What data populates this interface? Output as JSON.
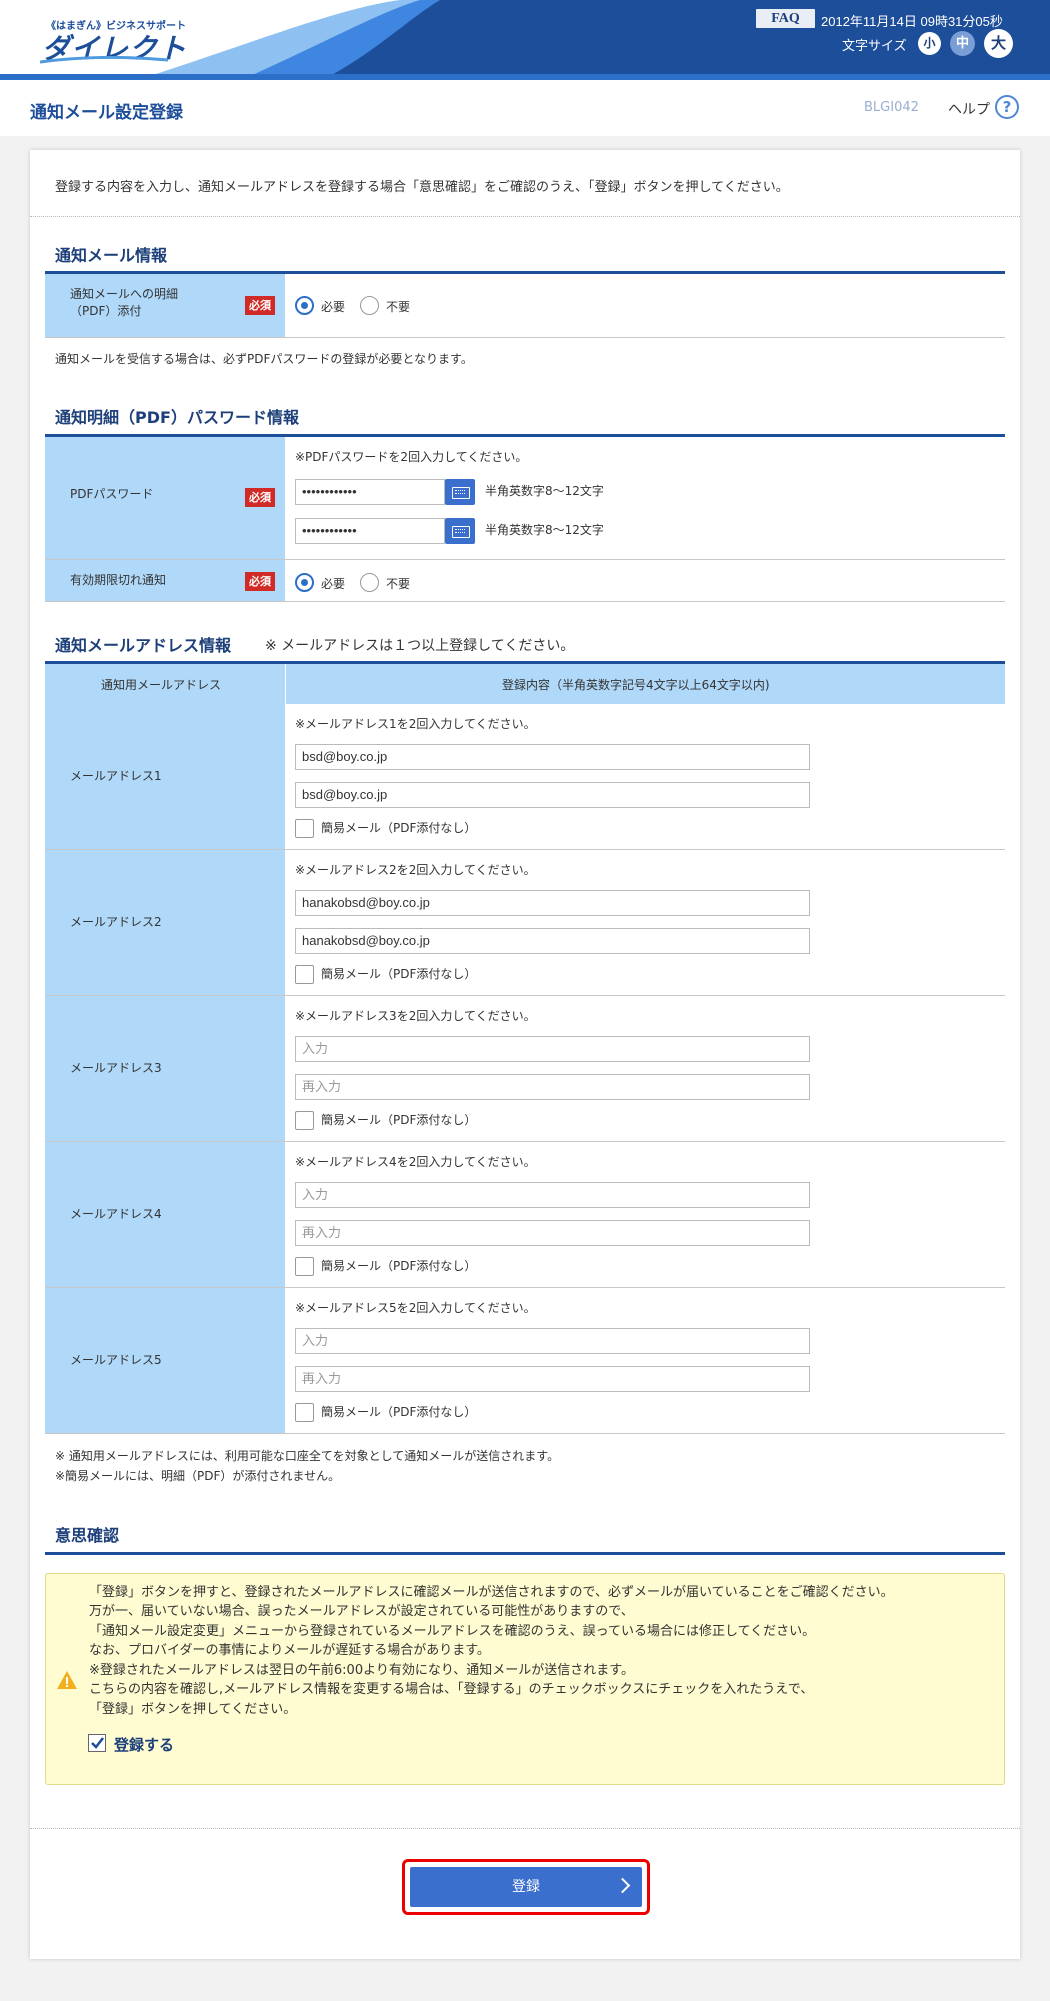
{
  "header": {
    "logo_small": "《はまぎん》ビジネスサポート",
    "logo_main": "ダイレクト",
    "faq": "FAQ",
    "datetime": "2012年11月14日 09時31分05秒",
    "font_size_label": "文字サイズ",
    "font_small": "小",
    "font_medium": "中",
    "font_large": "大"
  },
  "titlebar": {
    "title": "通知メール設定登録",
    "screen_id": "BLGI042",
    "help": "ヘルプ"
  },
  "instruction": "登録する内容を入力し、通知メールアドレスを登録する場合「意思確認」をご確認のうえ、「登録」ボタンを押してください。",
  "notify_info": {
    "heading": "通知メール情報",
    "label_line1": "通知メールへの明細",
    "label_line2": "（PDF）添付",
    "required": "必須",
    "opt_need": "必要",
    "opt_noneed": "不要",
    "note": "通知メールを受信する場合は、必ずPDFパスワードの登録が必要となります。"
  },
  "pdf_info": {
    "heading": "通知明細（PDF）パスワード情報",
    "pw_label": "PDFパスワード",
    "required": "必須",
    "pw_note": "※PDFパスワードを2回入力してください。",
    "pw_value1": "••••••••••••",
    "pw_value2": "••••••••••••",
    "pw_hint": "半角英数字8～12文字",
    "expire_label": "有効期限切れ通知",
    "opt_need": "必要",
    "opt_noneed": "不要"
  },
  "address_info": {
    "heading": "通知メールアドレス情報",
    "heading_note": "※ メールアドレスは１つ以上登録してください。",
    "col1": "通知用メールアドレス",
    "col2": "登録内容（半角英数字記号4文字以上64文字以内)",
    "simple_mail": "簡易メール（PDF添付なし）",
    "rows": [
      {
        "label": "メールアドレス1",
        "note": "※メールアドレス1を2回入力してください。",
        "v1": "bsd@boy.co.jp",
        "v2": "bsd@boy.co.jp"
      },
      {
        "label": "メールアドレス2",
        "note": "※メールアドレス2を2回入力してください。",
        "v1": "hanakobsd@boy.co.jp",
        "v2": "hanakobsd@boy.co.jp"
      },
      {
        "label": "メールアドレス3",
        "note": "※メールアドレス3を2回入力してください。",
        "p1": "入力",
        "p2": "再入力"
      },
      {
        "label": "メールアドレス4",
        "note": "※メールアドレス4を2回入力してください。",
        "p1": "入力",
        "p2": "再入力"
      },
      {
        "label": "メールアドレス5",
        "note": "※メールアドレス5を2回入力してください。",
        "p1": "入力",
        "p2": "再入力"
      }
    ],
    "foot1": "※ 通知用メールアドレスには、利用可能な口座全てを対象として通知メールが送信されます。",
    "foot2": "※簡易メールには、明細（PDF）が添付されません。"
  },
  "confirm": {
    "heading": "意思確認",
    "lines": [
      "「登録」ボタンを押すと、登録されたメールアドレスに確認メールが送信されますので、必ずメールが届いていることをご確認ください。",
      "万が一、届いていない場合、誤ったメールアドレスが設定されている可能性がありますので、",
      "「通知メール設定変更」メニューから登録されているメールアドレスを確認のうえ、誤っている場合には修正してください。",
      "なお、プロバイダーの事情によりメールが遅延する場合があります。",
      "※登録されたメールアドレスは翌日の午前6:00より有効になり、通知メールが送信されます。",
      "こちらの内容を確認し,メールアドレス情報を変更する場合は、「登録する」のチェックボックスにチェックを入れたうえで、",
      "「登録」ボタンを押してください。"
    ],
    "checkbox_label": "登録する"
  },
  "submit_label": "登録"
}
